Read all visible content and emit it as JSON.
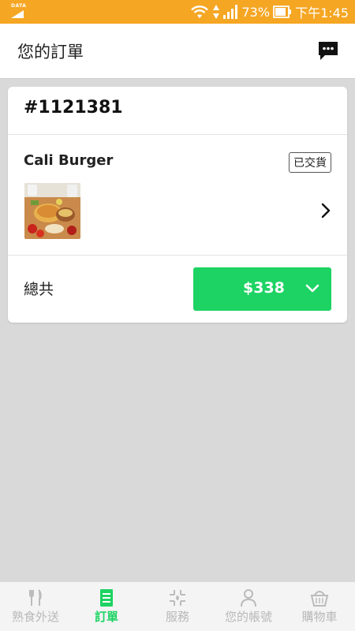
{
  "status_bar": {
    "data_label": "DATA",
    "battery": "73%",
    "time": "下午1:45"
  },
  "header": {
    "title": "您的訂單",
    "chat_icon": "chat-bubble-icon"
  },
  "order": {
    "number": "#1121381",
    "restaurant": "Cali Burger",
    "status": "已交貨",
    "total_label": "總共",
    "total_amount": "$338"
  },
  "nav": {
    "items": [
      {
        "label": "熟食外送",
        "icon": "utensils-icon"
      },
      {
        "label": "訂單",
        "icon": "list-icon"
      },
      {
        "label": "服務",
        "icon": "grid-icon"
      },
      {
        "label": "您的帳號",
        "icon": "person-icon"
      },
      {
        "label": "購物車",
        "icon": "basket-icon"
      }
    ]
  },
  "colors": {
    "status_bar": "#f5a623",
    "accent_green": "#1dd363",
    "background": "#d9d9d9"
  }
}
